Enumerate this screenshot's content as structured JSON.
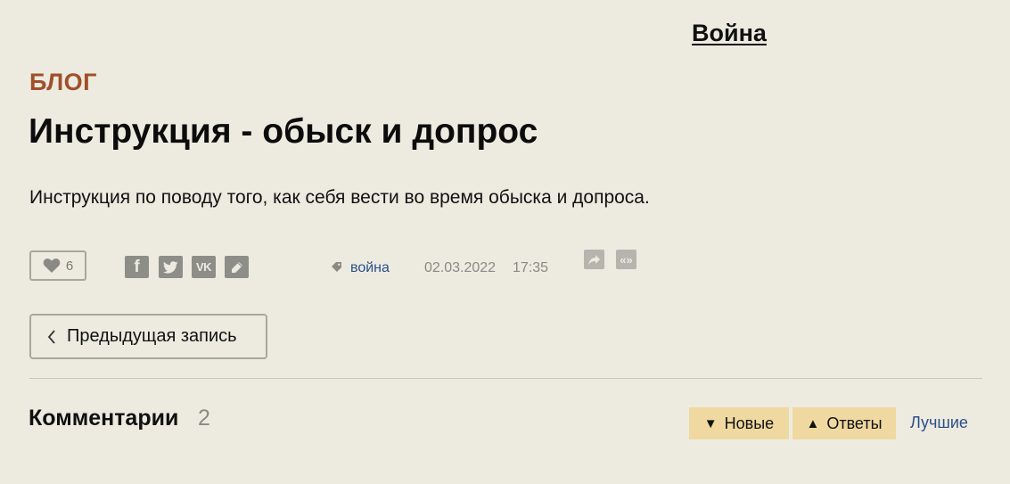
{
  "header": {
    "top_link": "Война"
  },
  "post": {
    "section": "БЛОГ",
    "title": "Инструкция - обыск и допрос",
    "description": "Инструкция по поводу того, как себя вести во время обыска и допроса."
  },
  "meta": {
    "likes": "6",
    "share_icons": [
      "facebook-icon",
      "twitter-icon",
      "vk-icon",
      "livejournal-icon"
    ],
    "tag": "война",
    "date": "02.03.2022",
    "time": "17:35"
  },
  "navigation": {
    "prev_label": "Предыдущая запись"
  },
  "comments": {
    "title": "Комментарии",
    "count": "2",
    "sort_new": "Новые",
    "sort_answers": "Ответы",
    "sort_best": "Лучшие"
  },
  "colors": {
    "background": "#edebe0",
    "section": "#a0502a",
    "link": "#2a4f8a",
    "sort_button": "#f0d9a0",
    "icon": "#8e8e88"
  }
}
